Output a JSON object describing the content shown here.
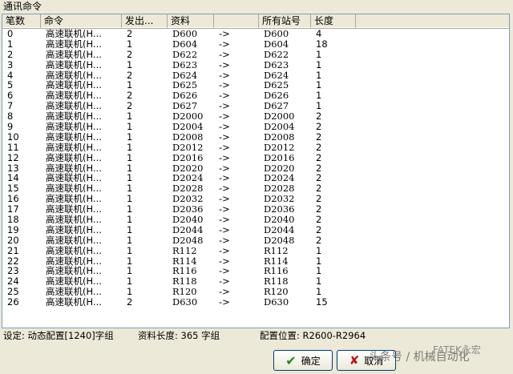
{
  "window": {
    "title": "通讯命令"
  },
  "table": {
    "headers": [
      "笔数",
      "命令",
      "发出...",
      "资料",
      "",
      "所有站号",
      "长度",
      ""
    ],
    "rows": [
      [
        "0",
        "高速联机(H...",
        "2",
        "D600",
        "->",
        "D600",
        "4"
      ],
      [
        "1",
        "高速联机(H...",
        "1",
        "D604",
        "->",
        "D604",
        "18"
      ],
      [
        "2",
        "高速联机(H...",
        "2",
        "D622",
        "->",
        "D622",
        "1"
      ],
      [
        "3",
        "高速联机(H...",
        "1",
        "D623",
        "->",
        "D623",
        "1"
      ],
      [
        "4",
        "高速联机(H...",
        "2",
        "D624",
        "->",
        "D624",
        "1"
      ],
      [
        "5",
        "高速联机(H...",
        "1",
        "D625",
        "->",
        "D625",
        "1"
      ],
      [
        "6",
        "高速联机(H...",
        "2",
        "D626",
        "->",
        "D626",
        "1"
      ],
      [
        "7",
        "高速联机(H...",
        "2",
        "D627",
        "->",
        "D627",
        "1"
      ],
      [
        "8",
        "高速联机(H...",
        "1",
        "D2000",
        "->",
        "D2000",
        "2"
      ],
      [
        "9",
        "高速联机(H...",
        "1",
        "D2004",
        "->",
        "D2004",
        "2"
      ],
      [
        "10",
        "高速联机(H...",
        "1",
        "D2008",
        "->",
        "D2008",
        "2"
      ],
      [
        "11",
        "高速联机(H...",
        "1",
        "D2012",
        "->",
        "D2012",
        "2"
      ],
      [
        "12",
        "高速联机(H...",
        "1",
        "D2016",
        "->",
        "D2016",
        "2"
      ],
      [
        "13",
        "高速联机(H...",
        "1",
        "D2020",
        "->",
        "D2020",
        "2"
      ],
      [
        "14",
        "高速联机(H...",
        "1",
        "D2024",
        "->",
        "D2024",
        "2"
      ],
      [
        "15",
        "高速联机(H...",
        "1",
        "D2028",
        "->",
        "D2028",
        "2"
      ],
      [
        "16",
        "高速联机(H...",
        "1",
        "D2032",
        "->",
        "D2032",
        "2"
      ],
      [
        "17",
        "高速联机(H...",
        "1",
        "D2036",
        "->",
        "D2036",
        "2"
      ],
      [
        "18",
        "高速联机(H...",
        "1",
        "D2040",
        "->",
        "D2040",
        "2"
      ],
      [
        "19",
        "高速联机(H...",
        "1",
        "D2044",
        "->",
        "D2044",
        "2"
      ],
      [
        "20",
        "高速联机(H...",
        "1",
        "D2048",
        "->",
        "D2048",
        "2"
      ],
      [
        "21",
        "高速联机(H...",
        "1",
        "R112",
        "->",
        "R112",
        "1"
      ],
      [
        "22",
        "高速联机(H...",
        "1",
        "R114",
        "->",
        "R114",
        "1"
      ],
      [
        "23",
        "高速联机(H...",
        "1",
        "R116",
        "->",
        "R116",
        "1"
      ],
      [
        "24",
        "高速联机(H...",
        "1",
        "R118",
        "->",
        "R118",
        "1"
      ],
      [
        "25",
        "高速联机(H...",
        "1",
        "R120",
        "->",
        "R120",
        "1"
      ],
      [
        "26",
        "高速联机(H...",
        "2",
        "D630",
        "->",
        "D630",
        "15"
      ]
    ]
  },
  "status": {
    "setting": "设定: 动态配置[1240]字组",
    "data_length": "资料长度: 365 字组",
    "config_position": "配置位置: R2600-R2964"
  },
  "buttons": {
    "ok": "确定",
    "cancel": "取消"
  },
  "watermark": {
    "text": "头条号 / 机械自动化",
    "logo": "FATEK永宏"
  }
}
